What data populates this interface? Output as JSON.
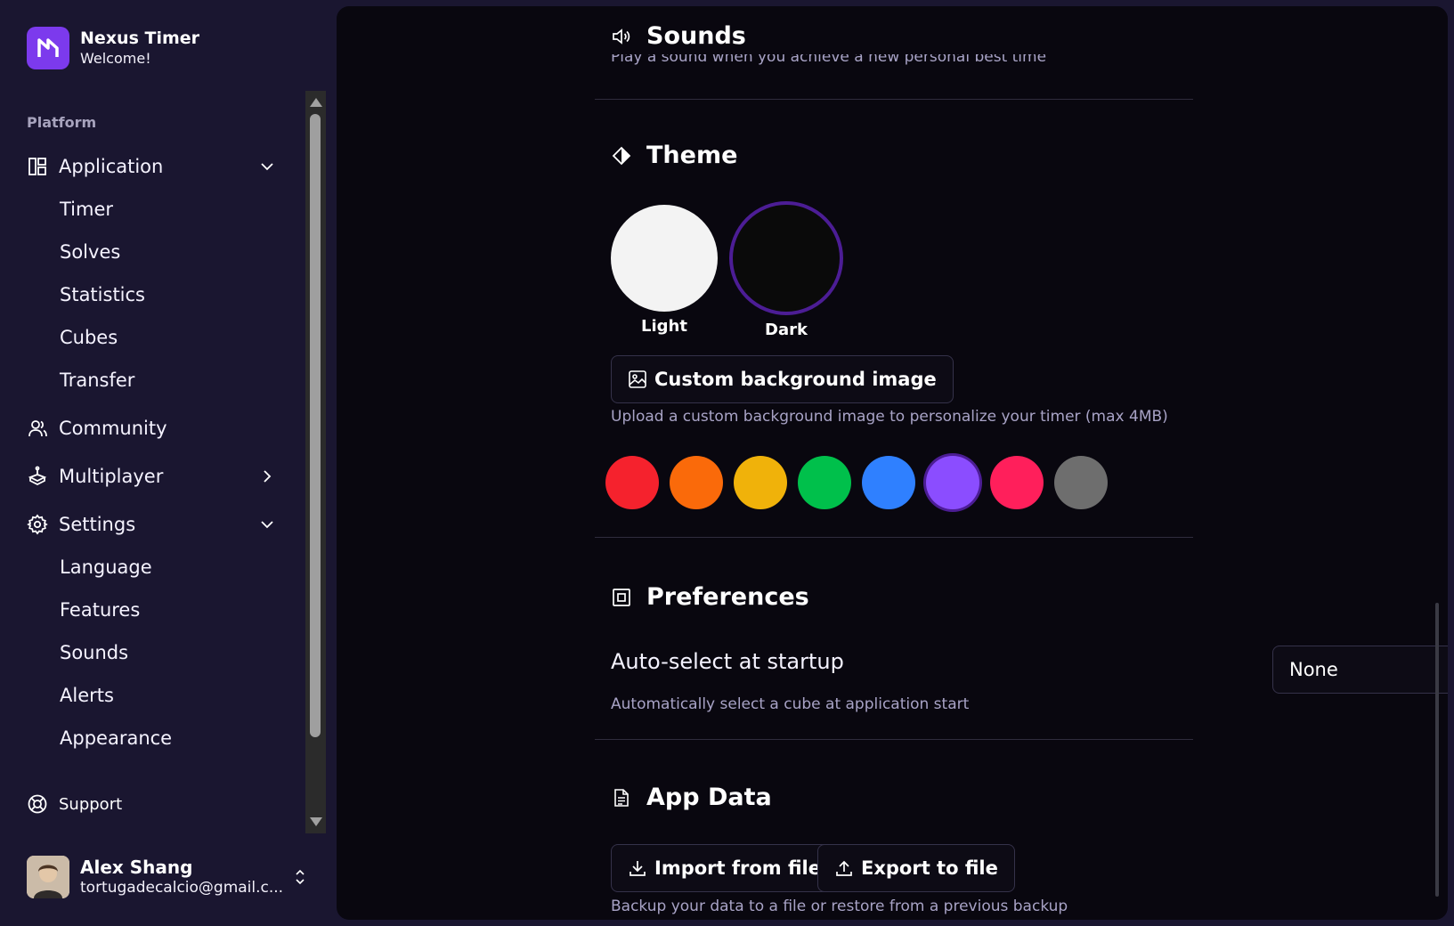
{
  "brand": {
    "name": "Nexus Timer",
    "subtitle": "Welcome!"
  },
  "sidebar": {
    "section_label": "Platform",
    "application": {
      "label": "Application",
      "icon": "layout-icon",
      "expanded": true,
      "children": [
        "Timer",
        "Solves",
        "Statistics",
        "Cubes",
        "Transfer"
      ]
    },
    "community": {
      "label": "Community",
      "icon": "users-icon"
    },
    "multiplayer": {
      "label": "Multiplayer",
      "icon": "gamepad-icon",
      "expanded": false
    },
    "settings": {
      "label": "Settings",
      "icon": "gear-icon",
      "expanded": true,
      "children": [
        "Language",
        "Features",
        "Sounds",
        "Alerts",
        "Appearance"
      ]
    },
    "support": {
      "label": "Support",
      "icon": "lifebuoy-icon"
    },
    "user": {
      "name": "Alex Shang",
      "email": "tortugadecalcio@gmail.c..."
    }
  },
  "main": {
    "sounds": {
      "title": "Sounds",
      "cut_text": "Play a sound when you achieve a new personal best time"
    },
    "theme": {
      "title": "Theme",
      "options": [
        {
          "label": "Light",
          "selected": false
        },
        {
          "label": "Dark",
          "selected": true
        }
      ],
      "custom_bg_button": "Custom background image",
      "custom_bg_hint": "Upload a custom background image to personalize your timer (max 4MB)",
      "accent_colors": [
        "#f5222d",
        "#fa6a0a",
        "#f0b20a",
        "#00c04b",
        "#2f80ff",
        "#8b4dff",
        "#ff1f5b",
        "#6e6e6e"
      ],
      "selected_accent": "#8b4dff"
    },
    "preferences": {
      "title": "Preferences",
      "auto_select_label": "Auto-select at startup",
      "auto_select_value": "None",
      "auto_select_hint": "Automatically select a cube at application start"
    },
    "app_data": {
      "title": "App Data",
      "import_label": "Import from file",
      "export_label": "Export to file",
      "hint": "Backup your data to a file or restore from a previous backup"
    }
  }
}
